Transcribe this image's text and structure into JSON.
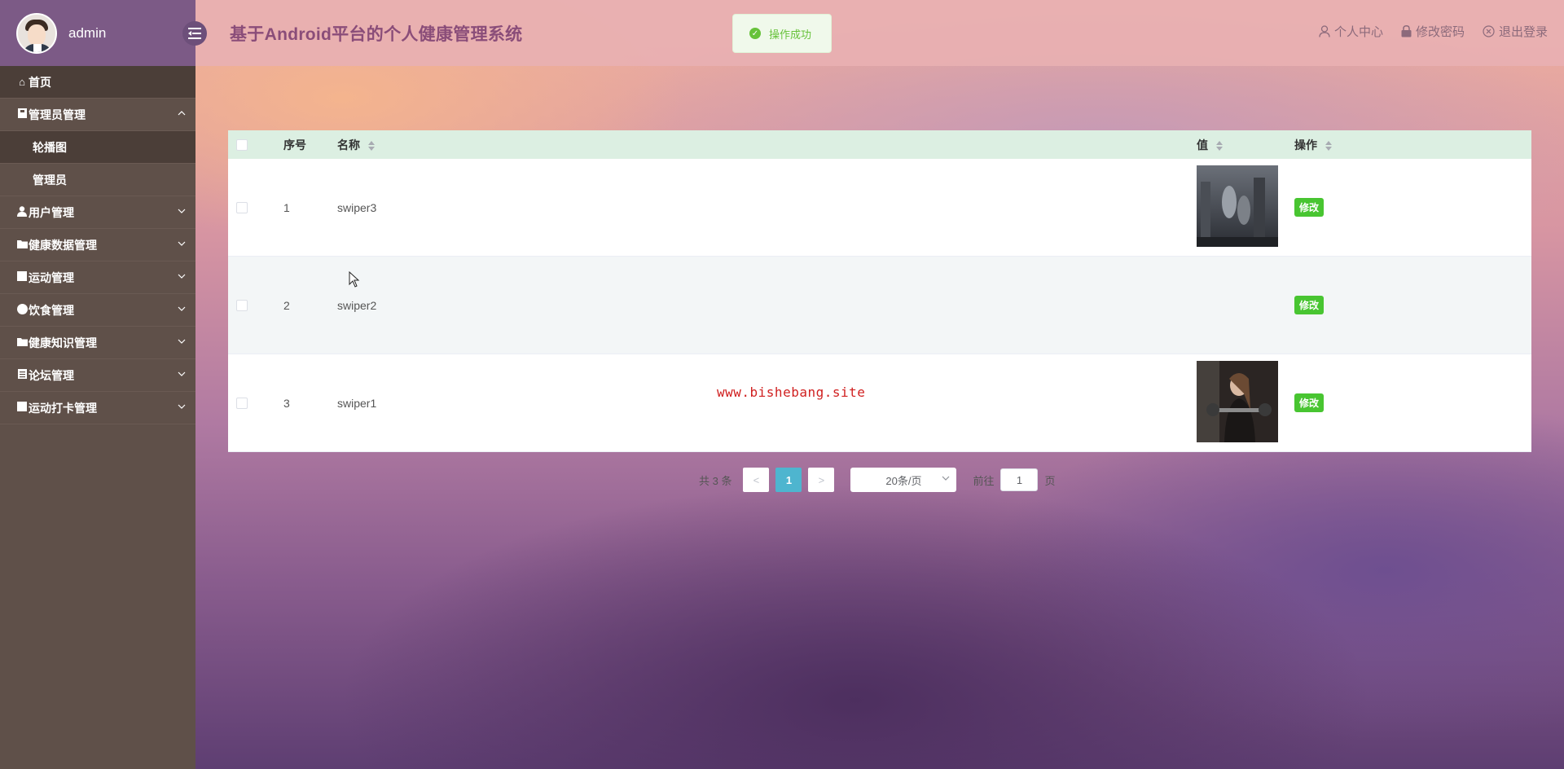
{
  "sidebar": {
    "username": "admin",
    "menu": [
      {
        "label": "首页",
        "icon": "home-icon"
      },
      {
        "label": "管理员管理",
        "icon": "book-icon",
        "expanded": true,
        "children": [
          {
            "label": "轮播图",
            "active": true
          },
          {
            "label": "管理员"
          }
        ]
      },
      {
        "label": "用户管理",
        "icon": "user-icon"
      },
      {
        "label": "健康数据管理",
        "icon": "folder-icon"
      },
      {
        "label": "运动管理",
        "icon": "square-icon"
      },
      {
        "label": "饮食管理",
        "icon": "circle-icon"
      },
      {
        "label": "健康知识管理",
        "icon": "folder-icon"
      },
      {
        "label": "论坛管理",
        "icon": "list-icon"
      },
      {
        "label": "运动打卡管理",
        "icon": "square-icon"
      }
    ]
  },
  "header": {
    "title": "基于Android平台的个人健康管理系统",
    "actions": {
      "profile": "个人中心",
      "password": "修改密码",
      "logout": "退出登录"
    }
  },
  "toast": {
    "text": "操作成功"
  },
  "table": {
    "columns": {
      "index": "序号",
      "name": "名称",
      "value": "值",
      "operation": "操作"
    },
    "rows": [
      {
        "index": "1",
        "name": "swiper3",
        "has_image": true,
        "image": "gym-photo-1",
        "action": "修改"
      },
      {
        "index": "2",
        "name": "swiper2",
        "has_image": false,
        "action": "修改"
      },
      {
        "index": "3",
        "name": "swiper1",
        "has_image": true,
        "image": "gym-photo-2",
        "action": "修改"
      }
    ]
  },
  "watermark": "www.bishebang.site",
  "pagination": {
    "total_text": "共 3 条",
    "prev": "<",
    "current": "1",
    "next": ">",
    "page_size": "20条/页",
    "goto_label": "前往",
    "goto_value": "1",
    "page_suffix": "页"
  },
  "colors": {
    "sidebar": "#5f5049",
    "sidebar_header": "#7c5a86",
    "topbar": "#e8b0b2",
    "title": "#8a4d79",
    "table_header": "#dcefe2",
    "edit_button": "#48c531",
    "pagination_active": "#4eb5cf",
    "toast": "#67c23a",
    "watermark": "#d02020"
  }
}
